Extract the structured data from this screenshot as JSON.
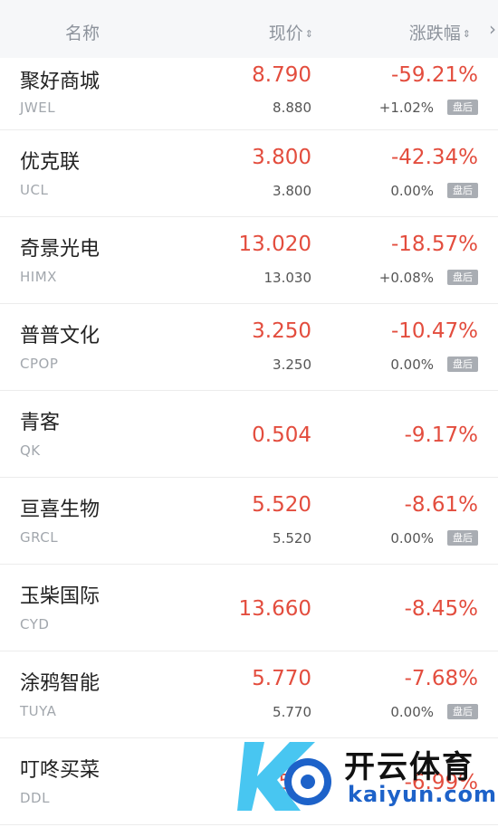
{
  "header": {
    "name_label": "名称",
    "price_label": "现价",
    "change_label": "涨跌幅",
    "sort_icon": "sort-updown-icon",
    "more_icon": "chevron-right-icon"
  },
  "colors": {
    "down_red": "#e34d3e",
    "badge_gray": "#a9adb3",
    "header_bg": "#f6f7f9"
  },
  "rows": [
    {
      "name": "聚好商城",
      "code": "JWEL",
      "price": "8.790",
      "change": "-59.21%",
      "ah_price": "8.880",
      "ah_change": "+1.02%",
      "badge": "盘后"
    },
    {
      "name": "优克联",
      "code": "UCL",
      "price": "3.800",
      "change": "-42.34%",
      "ah_price": "3.800",
      "ah_change": "0.00%",
      "badge": "盘后"
    },
    {
      "name": "奇景光电",
      "code": "HIMX",
      "price": "13.020",
      "change": "-18.57%",
      "ah_price": "13.030",
      "ah_change": "+0.08%",
      "badge": "盘后"
    },
    {
      "name": "普普文化",
      "code": "CPOP",
      "price": "3.250",
      "change": "-10.47%",
      "ah_price": "3.250",
      "ah_change": "0.00%",
      "badge": "盘后"
    },
    {
      "name": "青客",
      "code": "QK",
      "price": "0.504",
      "change": "-9.17%"
    },
    {
      "name": "亘喜生物",
      "code": "GRCL",
      "price": "5.520",
      "change": "-8.61%",
      "ah_price": "5.520",
      "ah_change": "0.00%",
      "badge": "盘后"
    },
    {
      "name": "玉柴国际",
      "code": "CYD",
      "price": "13.660",
      "change": "-8.45%"
    },
    {
      "name": "涂鸦智能",
      "code": "TUYA",
      "price": "5.770",
      "change": "-7.68%",
      "ah_price": "5.770",
      "ah_change": "0.00%",
      "badge": "盘后"
    },
    {
      "name": "叮咚买菜",
      "code": "DDL",
      "price": "5.0",
      "change": "-6.99%"
    }
  ],
  "watermark": {
    "title": "开云体育",
    "url": "kaiyun.com"
  }
}
